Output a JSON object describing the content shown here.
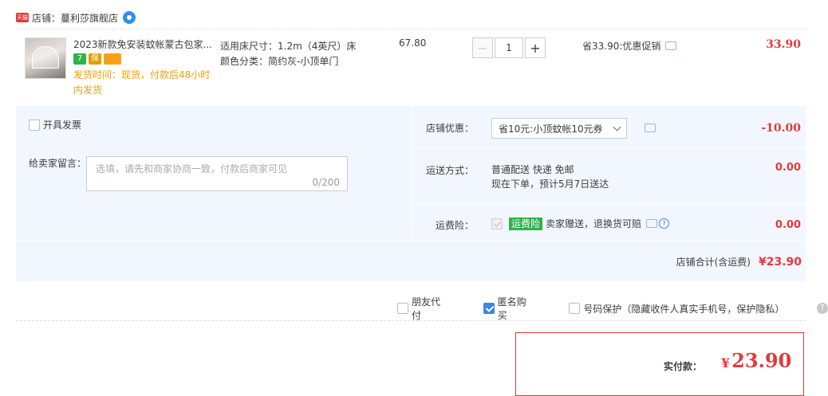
{
  "shop": {
    "tmall_badge": "天猫",
    "label": "店铺：蔓利莎旗舰店"
  },
  "item": {
    "title": "2023新款免安装蚊帐蒙古包家...",
    "badges": [
      "7",
      "保",
      ""
    ],
    "delivery": "发货时间：现货，付款后48小时内发货",
    "sku_size": "适用床尺寸：1.2m（4英尺）床",
    "sku_color": "颜色分类：简约灰-小顶单门",
    "unit_price": "67.80",
    "quantity": "1",
    "qty_minus": "−",
    "qty_plus": "+",
    "promo": "省33.90:优惠促销",
    "subtotal": "33.90"
  },
  "services": {
    "invoice_label": "开具发票",
    "message_label": "给卖家留言：",
    "message_placeholder": "选填，请先和商家协商一致，付款后商家可见",
    "message_count": "0/200",
    "shop_discount_label": "店铺优惠：",
    "shop_discount_value": "省10元:小顶蚊帐10元券",
    "shop_discount_amount": "-10.00",
    "shipping_label": "运送方式：",
    "shipping_method": "普通配送 快递 免邮",
    "shipping_eta": "现在下单，预计5月7日送达",
    "shipping_amount": "0.00",
    "insurance_label": "运费险：",
    "insurance_tag": "运费险",
    "insurance_desc": "卖家赠送，退换货可赔",
    "insurance_amount": "0.00",
    "shop_total_label": "店铺合计(含运费)",
    "shop_total_amount": "¥23.90"
  },
  "options": {
    "friend_pay": "朋友代付",
    "anonymous": "匿名购买",
    "number_protect": "号码保护（隐藏收件人真实手机号，保护隐私）",
    "help": "?"
  },
  "payment": {
    "label": "实付款：",
    "currency": "¥",
    "amount": "23.90"
  },
  "colors": {
    "accent_red": "#e4393c",
    "panel_bg": "#f2f7ff",
    "checkbox_blue": "#3a85e8",
    "insurance_green": "#2cb34a",
    "delivery_orange": "#f0a000"
  }
}
